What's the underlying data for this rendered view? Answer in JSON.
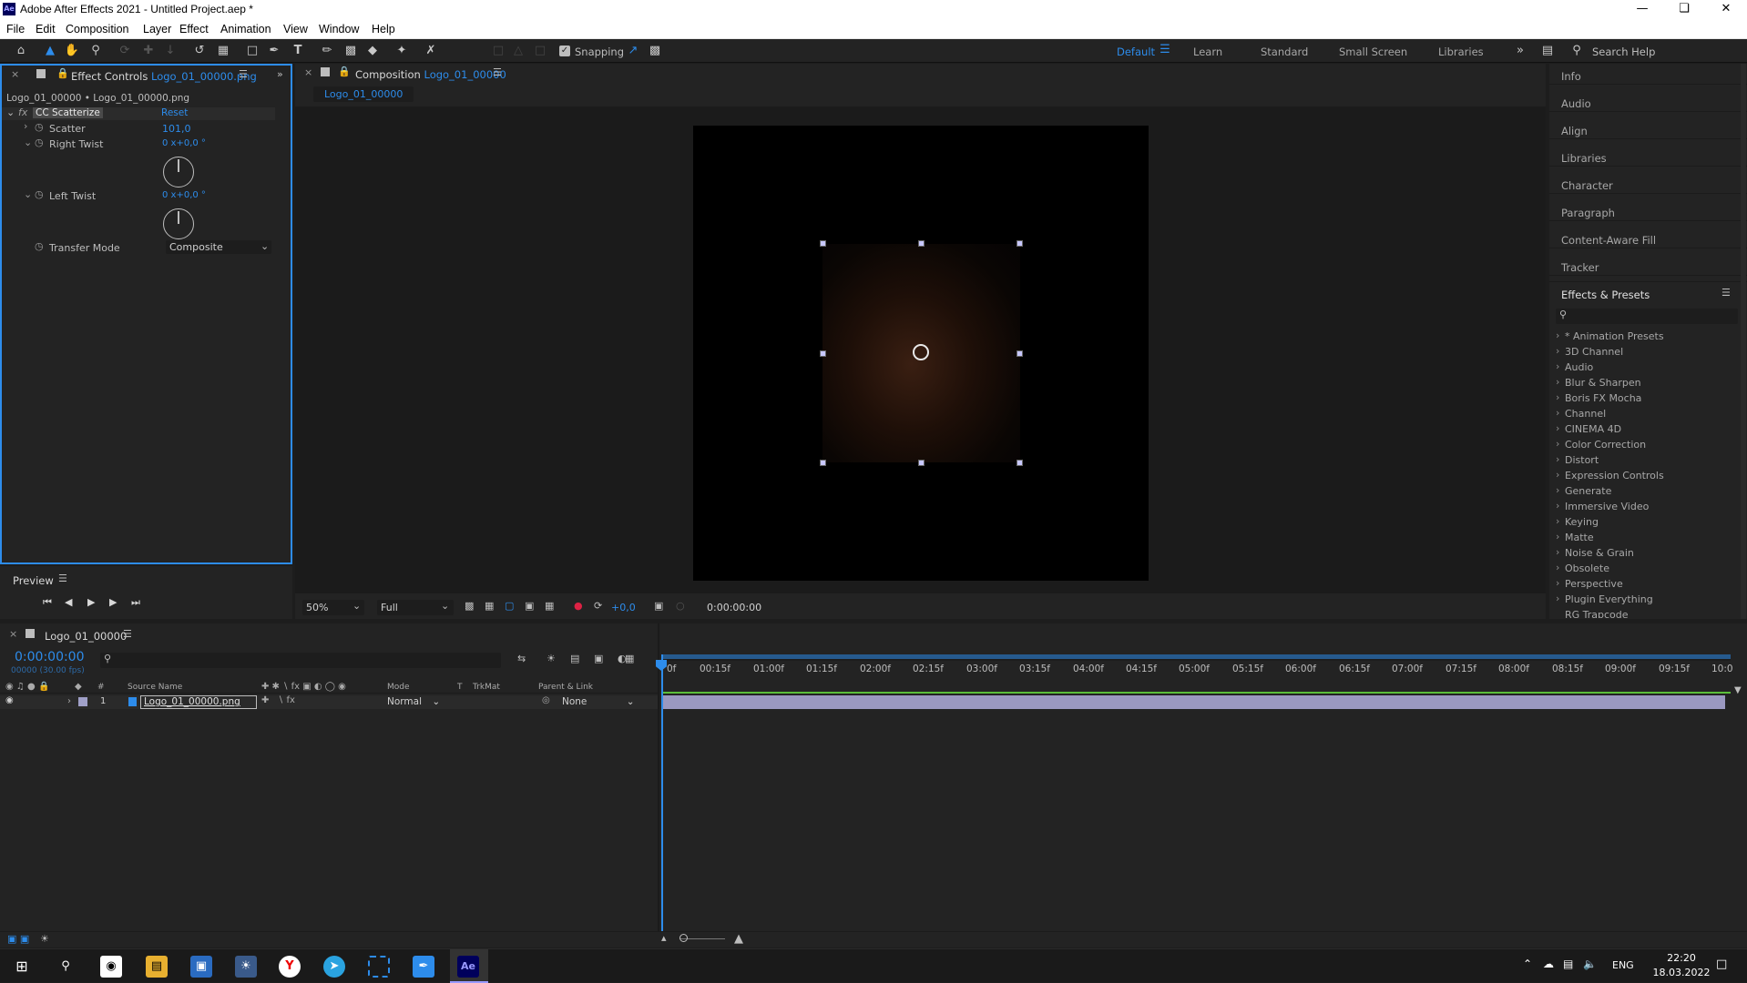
{
  "title_bar": {
    "app_badge": "Ae",
    "title": "Adobe After Effects 2021 - Untitled Project.aep *"
  },
  "menu": [
    "File",
    "Edit",
    "Composition",
    "Layer",
    "Effect",
    "Animation",
    "View",
    "Window",
    "Help"
  ],
  "toolbar": {
    "snapping_label": "Snapping",
    "workspaces": [
      "Default",
      "Learn",
      "Standard",
      "Small Screen",
      "Libraries"
    ],
    "active_workspace": "Default",
    "search_placeholder": "Search Help"
  },
  "effect_controls": {
    "tab_prefix": "Effect Controls",
    "tab_layer": "Logo_01_00000.png",
    "breadcrumb": "Logo_01_00000 • Logo_01_00000.png",
    "effect_badge": "fx",
    "effect_name": "CC Scatterize",
    "reset_label": "Reset",
    "props": [
      {
        "name": "Scatter",
        "value": "101,0"
      },
      {
        "name": "Right Twist",
        "value": "0 x+0,0 °"
      },
      {
        "name": "Left Twist",
        "value": "0 x+0,0 °"
      },
      {
        "name": "Transfer Mode",
        "value": "Composite"
      }
    ]
  },
  "preview": {
    "label": "Preview"
  },
  "composition": {
    "tab_prefix": "Composition",
    "tab_name": "Logo_01_00000",
    "sub_tab": "Logo_01_00000",
    "zoom": "50%",
    "resolution": "Full",
    "exposure": "+0,0",
    "timecode": "0:00:00:00"
  },
  "right_panel": {
    "items": [
      "Info",
      "Audio",
      "Align",
      "Libraries",
      "Character",
      "Paragraph",
      "Content-Aware Fill",
      "Tracker"
    ],
    "effects_title": "Effects & Presets",
    "effects": [
      "* Animation Presets",
      "3D Channel",
      "Audio",
      "Blur & Sharpen",
      "Boris FX Mocha",
      "Channel",
      "CINEMA 4D",
      "Color Correction",
      "Distort",
      "Expression Controls",
      "Generate",
      "Immersive Video",
      "Keying",
      "Matte",
      "Noise & Grain",
      "Obsolete",
      "Perspective",
      "Plugin Everything",
      "RG Trapcode"
    ]
  },
  "timeline": {
    "tab_name": "Logo_01_00000",
    "timecode": "0:00:00:00",
    "fps": "00000 (30.00 fps)",
    "columns": {
      "source_name": "Source Name",
      "mode": "Mode",
      "t": "T",
      "trkmat": "TrkMat",
      "parent": "Parent & Link"
    },
    "layer": {
      "index": "1",
      "name": "Logo_01_00000.png",
      "mode": "Normal",
      "parent": "None"
    },
    "ruler": [
      "0f",
      "00:15f",
      "01:00f",
      "01:15f",
      "02:00f",
      "02:15f",
      "03:00f",
      "03:15f",
      "04:00f",
      "04:15f",
      "05:00f",
      "05:15f",
      "06:00f",
      "06:15f",
      "07:00f",
      "07:15f",
      "08:00f",
      "08:15f",
      "09:00f",
      "09:15f",
      "10:0"
    ]
  },
  "taskbar": {
    "lang": "ENG",
    "time": "22:20",
    "date": "18.03.2022",
    "ae_label": "Ae"
  }
}
